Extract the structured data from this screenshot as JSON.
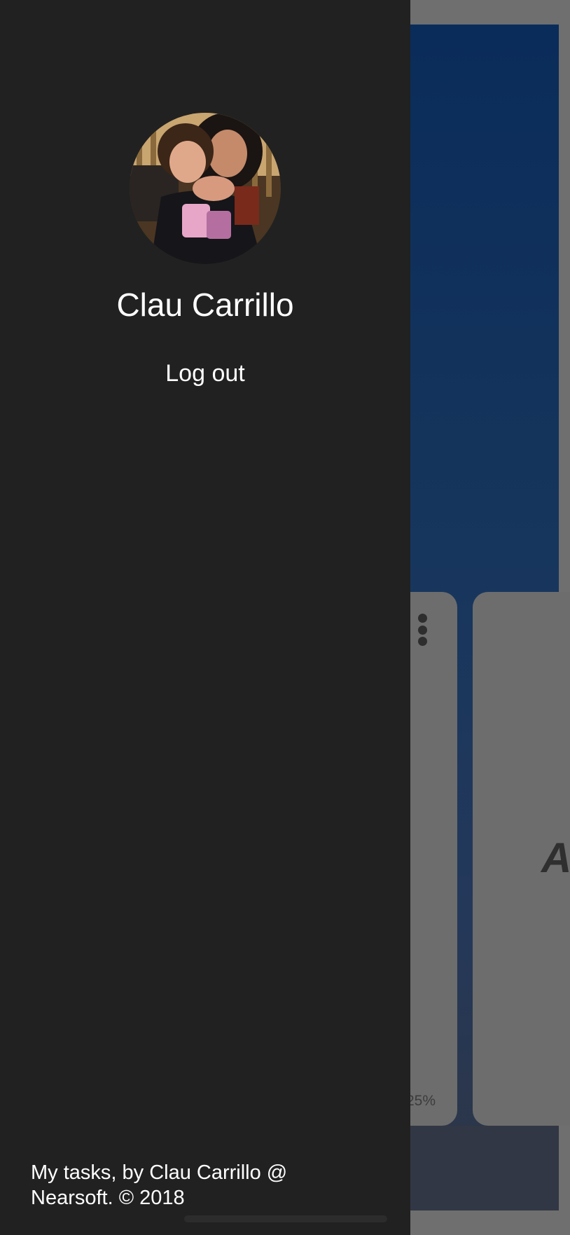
{
  "drawer": {
    "user_name": "Clau Carrillo",
    "logout_label": "Log out",
    "credits_line1": "My tasks, by Clau Carrillo @",
    "credits_line2": "Nearsoft. © 2018"
  },
  "background": {
    "card_percent": "25%",
    "card_letter": "A",
    "more_icon": "more-vertical-icon"
  },
  "colors": {
    "drawer": "#212121",
    "overlay": "#6f6f6f",
    "header_gradient_top": "#0a2c5a",
    "footer": "#323745"
  }
}
